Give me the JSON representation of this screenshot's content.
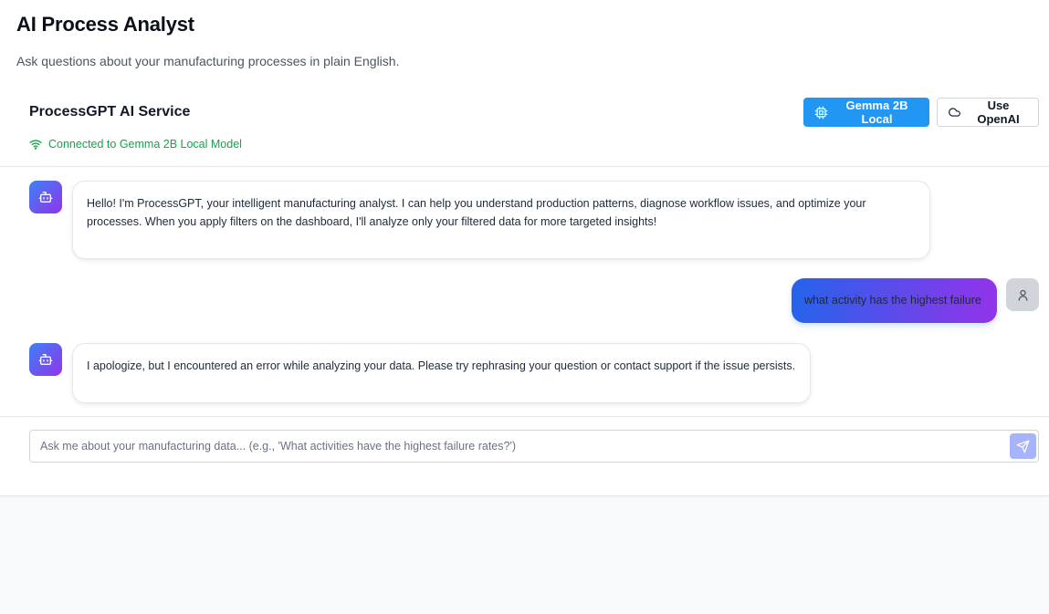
{
  "header": {
    "title": "AI Process Analyst",
    "subtitle": "Ask questions about your manufacturing processes in plain English."
  },
  "service": {
    "title": "ProcessGPT AI Service",
    "status": "Connected to Gemma 2B Local Model",
    "status_color": "#16a34a",
    "buttons": {
      "local_label": "Gemma 2B Local",
      "local_icon": "cpu-chip-icon",
      "openai_label": "Use OpenAI",
      "openai_icon": "cloud-icon"
    },
    "accent_color": "#2196f3"
  },
  "messages": [
    {
      "role": "assistant",
      "icon": "bot-icon",
      "text": "Hello! I'm ProcessGPT, your intelligent manufacturing analyst. I can help you understand production patterns, diagnose workflow issues, and optimize your processes. When you apply filters on the dashboard, I'll analyze only your filtered data for more targeted insights!"
    },
    {
      "role": "user",
      "icon": "user-icon",
      "text": "what activity has the highest failure"
    },
    {
      "role": "assistant",
      "icon": "bot-icon",
      "text": "I apologize, but I encountered an error while analyzing your data. Please try rephrasing your question or contact support if the issue persists."
    }
  ],
  "composer": {
    "placeholder": "Ask me about your manufacturing data... (e.g., 'What activities have the highest failure rates?')",
    "send_icon": "send-icon"
  }
}
